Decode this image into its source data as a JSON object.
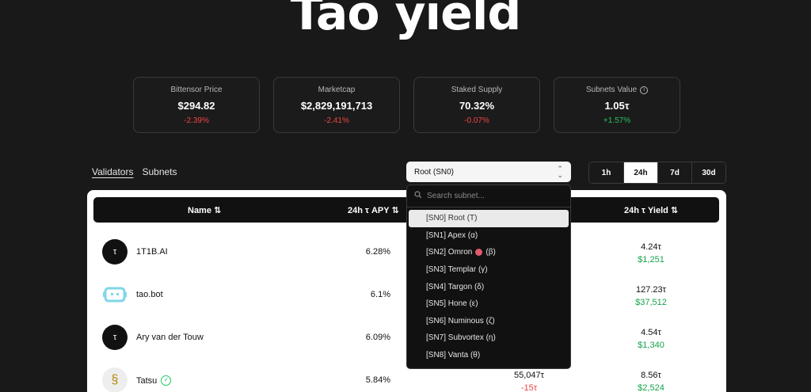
{
  "hero": {
    "title": "Tao yield"
  },
  "stats": [
    {
      "label": "Bittensor Price",
      "value": "$294.82",
      "change": "-2.39%",
      "trend": "neg"
    },
    {
      "label": "Marketcap",
      "value": "$2,829,191,713",
      "change": "-2.41%",
      "trend": "neg"
    },
    {
      "label": "Staked Supply",
      "value": "70.32%",
      "change": "-0.07%",
      "trend": "neg"
    },
    {
      "label": "Subnets Value",
      "value": "1.05τ",
      "change": "+1.57%",
      "trend": "pos",
      "info_icon": "info-icon"
    }
  ],
  "view_tabs": {
    "validators": "Validators",
    "subnets": "Subnets",
    "active": "Validators"
  },
  "subnet_select": {
    "value": "Root (SN0)"
  },
  "range_tabs": {
    "items": [
      "1h",
      "24h",
      "7d",
      "30d"
    ],
    "active": "24h"
  },
  "table": {
    "headers": {
      "name": "Name ⇅",
      "apy": "24h τ APY ⇅",
      "yield": "24h τ Yield ⇅"
    },
    "rows": [
      {
        "name": "1T1B.AI",
        "avatar": "τ",
        "apy": "6.28%",
        "stake": "",
        "stake_change": "",
        "yield_tau": "4.24τ",
        "yield_usd": "$1,251"
      },
      {
        "name": "tao.bot",
        "avatar": "bot-icon",
        "apy": "6.1%",
        "stake": "",
        "stake_change": "",
        "yield_tau": "127.23τ",
        "yield_usd": "$37,512"
      },
      {
        "name": "Ary van der Touw",
        "avatar": "τ",
        "apy": "6.09%",
        "stake": "",
        "stake_change": "",
        "yield_tau": "4.54τ",
        "yield_usd": "$1,340"
      },
      {
        "name": "Tatsu",
        "avatar": "tatsu-logo",
        "verified": true,
        "apy": "5.84%",
        "stake": "55,047τ",
        "stake_change": "-15τ",
        "yield_tau": "8.56τ",
        "yield_usd": "$2,524"
      }
    ]
  },
  "dropdown": {
    "search_placeholder": "Search subnet...",
    "items": [
      "[SN0] Root (Τ)",
      "[SN1] Apex (α)",
      "[SN2] Omron",
      "[SN3] Templar (γ)",
      "[SN4] Targon (δ)",
      "[SN5] Hone (ε)",
      "[SN6] Numinous (ζ)",
      "[SN7] Subvortex (η)",
      "[SN8] Vanta (θ)"
    ],
    "omron_suffix": "(β)",
    "selected_index": 0
  },
  "colors": {
    "negative": "#ef4444",
    "positive": "#22c55e",
    "background": "#1a1919"
  }
}
